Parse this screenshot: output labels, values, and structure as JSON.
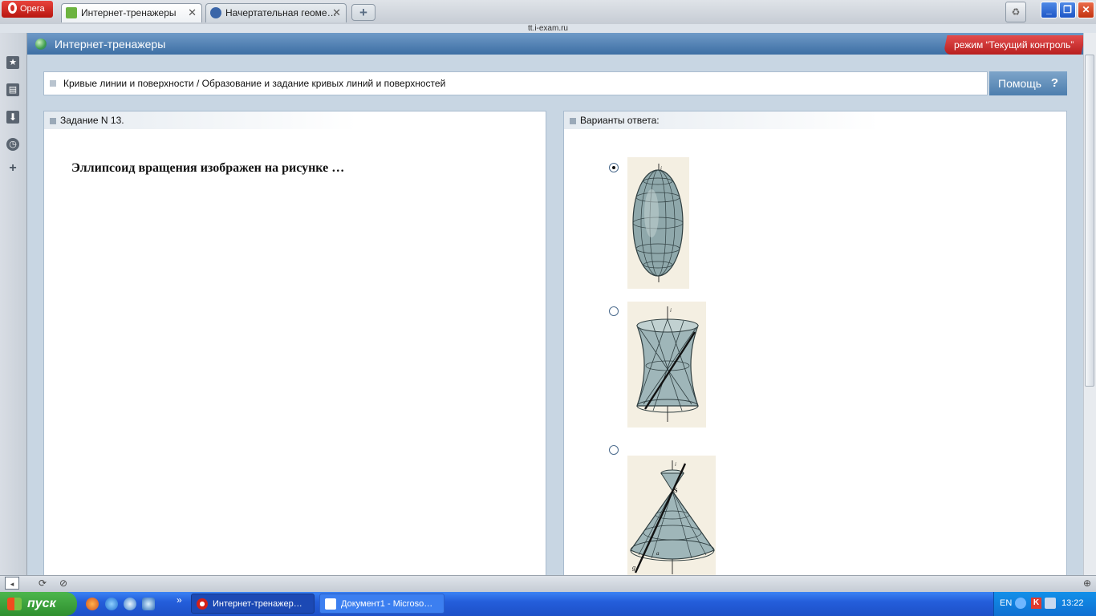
{
  "browser": {
    "menu_button": "Opera",
    "tabs": [
      {
        "label": "Интернет-тренажеры",
        "active": true
      },
      {
        "label": "Начертательная геоме…",
        "active": false
      }
    ],
    "new_tab_symbol": "+",
    "address": "tt.i-exam.ru",
    "side_icons": [
      "bookmarks-icon",
      "notes-icon",
      "downloads-icon",
      "history-icon",
      "add-panel-icon"
    ]
  },
  "app": {
    "title": "Интернет-тренажеры",
    "mode": "режим “Текущий контроль”",
    "breadcrumb": "Кривые линии и поверхности / Образование и задание кривых линий и поверхностей",
    "help": "Помощь",
    "help_symbol": "?"
  },
  "task": {
    "header": "Задание N 13.",
    "question": "Эллипсоид вращения изображен на рисунке …"
  },
  "answers": {
    "header": "Варианты ответа:",
    "options": [
      {
        "shape": "ellipsoid-of-revolution",
        "selected": true
      },
      {
        "shape": "one-sheet-hyperboloid",
        "selected": false
      },
      {
        "shape": "cone-of-revolution",
        "selected": false
      }
    ],
    "figure_labels": {
      "axis": "i",
      "apex": "S",
      "generatrix": "g",
      "curve": "a"
    }
  },
  "taskbar": {
    "start": "пуск",
    "tasks": [
      "Интернет-тренажер…",
      "Документ1 - Microso…"
    ],
    "more": "»",
    "lang": "EN",
    "clock": "13:22"
  }
}
